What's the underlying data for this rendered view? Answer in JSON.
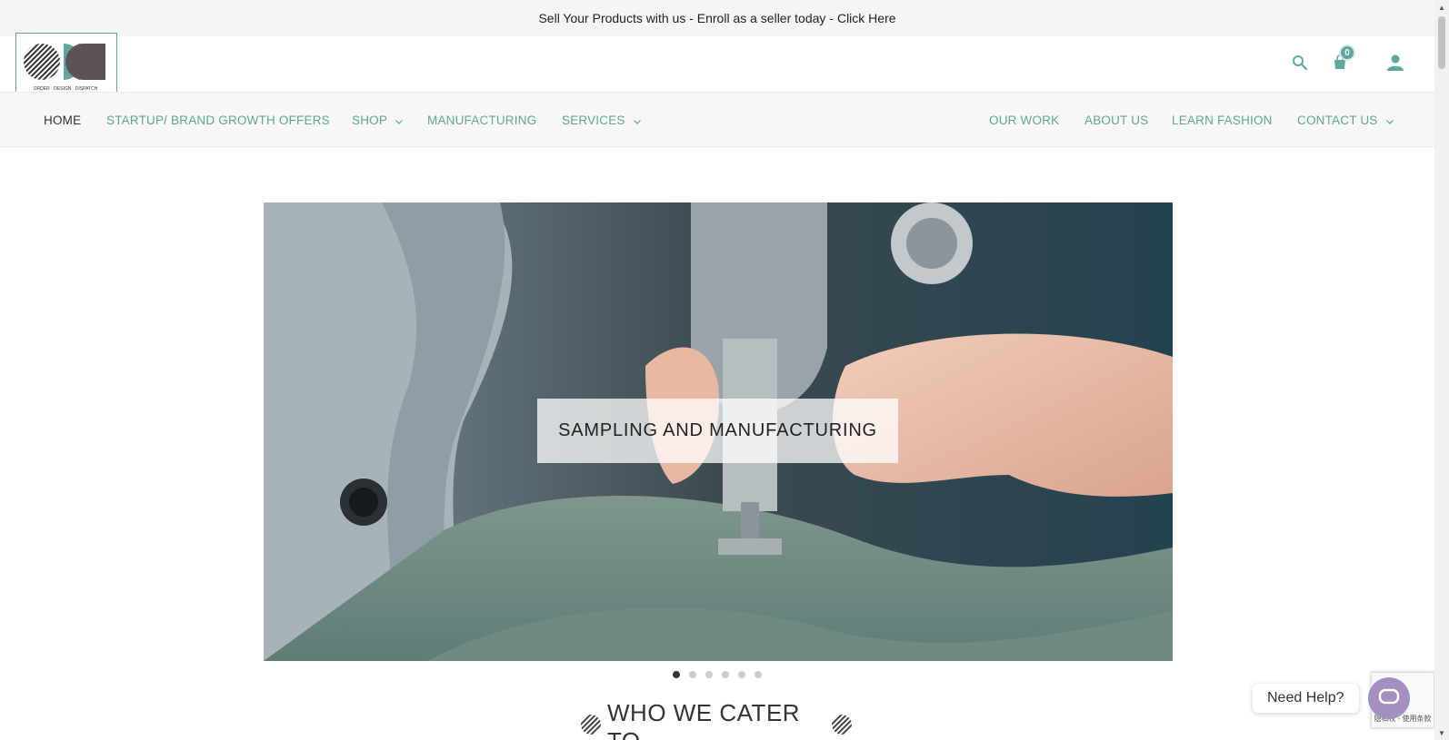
{
  "announcement": {
    "message": "Sell Your Products with us - Enroll as a seller today -",
    "link_label": "Click Here"
  },
  "logo": {
    "tagline": "ORDER · DESIGN · DISPATCH"
  },
  "header": {
    "cart_count": "0",
    "icons": [
      "search-icon",
      "cart-icon",
      "account-icon"
    ]
  },
  "nav": {
    "left": [
      {
        "label": "HOME",
        "active": true
      },
      {
        "label": "STARTUP/ BRAND GROWTH OFFERS"
      },
      {
        "label": "SHOP",
        "dropdown": true
      },
      {
        "label": "MANUFACTURING"
      },
      {
        "label": "SERVICES",
        "dropdown": true
      }
    ],
    "right": [
      {
        "label": "OUR WORK"
      },
      {
        "label": "ABOUT US"
      },
      {
        "label": "LEARN FASHION"
      },
      {
        "label": "CONTACT US",
        "dropdown": true
      }
    ]
  },
  "hero": {
    "caption": "SAMPLING AND MANUFACTURING",
    "slide_count": 6,
    "active_slide": 0
  },
  "section": {
    "title": "WHO WE CATER TO"
  },
  "help_widget": {
    "label": "Need Help?"
  },
  "recaptcha": {
    "text": "隐私权 - 使用条款"
  },
  "colors": {
    "accent": "#5fa69b",
    "brand_dark": "#5b5356",
    "topbar_bg": "#f5f5f5",
    "chat_button": "#a48fc2"
  }
}
